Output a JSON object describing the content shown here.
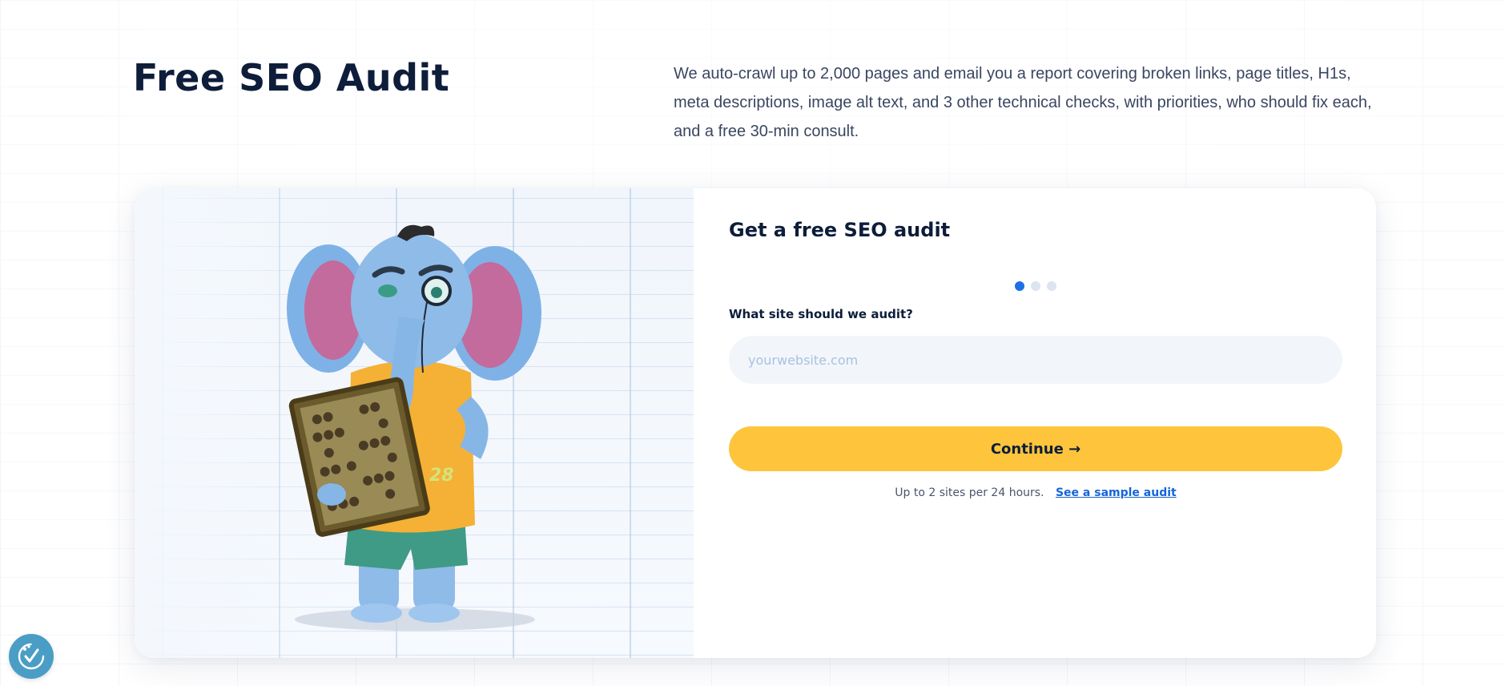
{
  "hero": {
    "title": "Free SEO Audit",
    "description": "We auto-crawl up to 2,000 pages and email you a report covering broken links, page titles, H1s, meta descriptions, image alt text, and 3 other technical checks, with priorities, who should fix each, and a free 30-min consult."
  },
  "illustration": {
    "mascot_icon": "elephant-with-abacus-mascot"
  },
  "form": {
    "title": "Get a free SEO audit",
    "steps": {
      "total": 3,
      "current": 1
    },
    "site_label": "What site should we audit?",
    "site_value": "",
    "site_placeholder": "yourwebsite.com",
    "continue_label": "Continue →",
    "limit_text": "Up to 2 sites per 24 hours.",
    "sample_link": "See a sample audit"
  },
  "accessibility": {
    "icon": "accessibility-check-icon"
  },
  "colors": {
    "title": "#0d1d3a",
    "accent_yellow": "#fec53c",
    "link_blue": "#1565d8",
    "step_active": "#1f6fe5",
    "step_inactive": "#dbe4ef",
    "input_bg": "#f2f6fb",
    "a11y_bg": "#4a9ec6"
  }
}
